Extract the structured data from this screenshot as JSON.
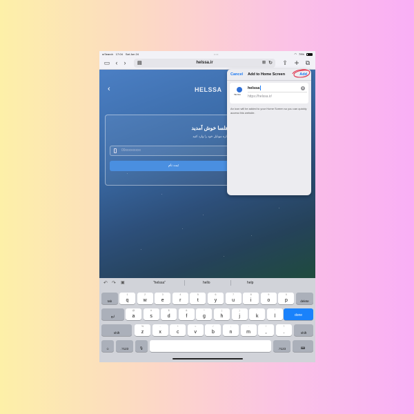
{
  "status_bar": {
    "back_app": "◂ Search",
    "time": "17:04",
    "date": "Sat Jun 24",
    "battery": "79%"
  },
  "toolbar": {
    "url": "helssa.ir"
  },
  "website": {
    "brand": "HELSSA",
    "welcome": "به هلسا خوش آمدید",
    "subtitle": "با شماره موبایل خود را وارد کنید",
    "phone_placeholder": "09xxxxxxxxx",
    "signup_button": "ثبت نام"
  },
  "add_to_home": {
    "cancel": "Cancel",
    "title": "Add to Home Screen",
    "add": "Add",
    "icon_label": "HELSSA",
    "name_value": "helssa",
    "url": "https://helssa.ir/",
    "description": "An icon will be added to your Home Screen so you can quickly access this website."
  },
  "keyboard": {
    "suggestions": [
      "“helssa”",
      "hello",
      "help"
    ],
    "row1": [
      [
        "1",
        "q"
      ],
      [
        "2",
        "w"
      ],
      [
        "3",
        "e"
      ],
      [
        "4",
        "r"
      ],
      [
        "5",
        "t"
      ],
      [
        "6",
        "y"
      ],
      [
        "7",
        "u"
      ],
      [
        "8",
        "i"
      ],
      [
        "9",
        "o"
      ],
      [
        "0",
        "p"
      ]
    ],
    "row2": [
      [
        "@",
        "a"
      ],
      [
        "#",
        "s"
      ],
      [
        "$",
        "d"
      ],
      [
        "&",
        "f"
      ],
      [
        "*",
        "g"
      ],
      [
        "(",
        "h"
      ],
      [
        ")",
        "j"
      ],
      [
        "'",
        "k"
      ],
      [
        "\"",
        "l"
      ]
    ],
    "row3": [
      [
        "%",
        "z"
      ],
      [
        "-",
        "x"
      ],
      [
        "+",
        "c"
      ],
      [
        "=",
        "v"
      ],
      [
        "/",
        "b"
      ],
      [
        ";",
        "n"
      ],
      [
        ":",
        "m"
      ],
      [
        "!",
        ","
      ],
      [
        "?",
        "."
      ]
    ],
    "tab": "tab",
    "delete": "delete",
    "lang": "ابج",
    "done": "done",
    "shift": "shift",
    "num": ".?123",
    "emoji_icon": "emoji-icon",
    "mic_icon": "mic-icon",
    "hide_icon": "keyboard-hide-icon"
  },
  "colors": {
    "accent": "#1877f2",
    "done_key": "#1a82fb",
    "annotation": "#e0304a"
  }
}
